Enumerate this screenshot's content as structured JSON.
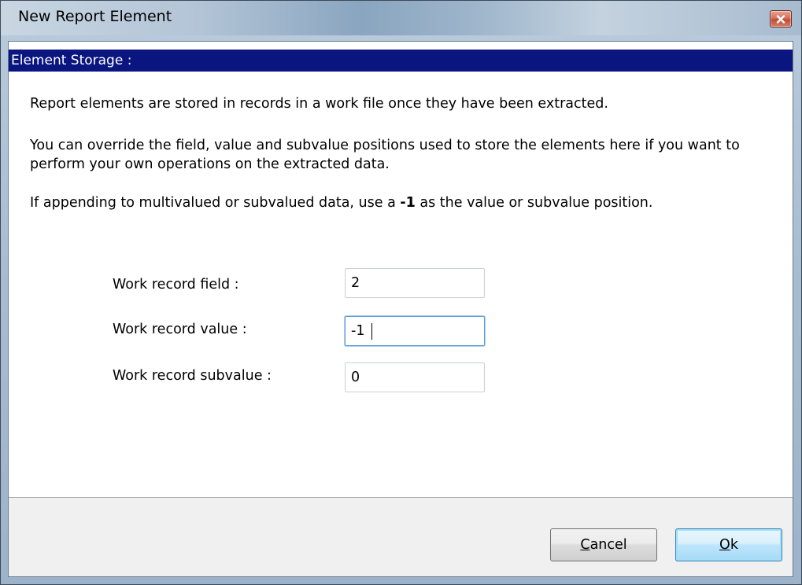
{
  "window": {
    "title": "New Report Element",
    "close_icon": "close-icon"
  },
  "section": {
    "header": "Element Storage :"
  },
  "description": {
    "p1": "Report elements are stored in records in a work file once they have been extracted.",
    "p2": "You can override the field, value and subvalue positions used to store the elements here if you want to perform your own operations on the extracted data.",
    "p3_before": "If appending to multivalued or subvalued data, use a ",
    "p3_bold": "-1",
    "p3_after": " as the value or subvalue position."
  },
  "fields": {
    "field_label": "Work record field :",
    "field_value": "2",
    "value_label": "Work record value :",
    "value_value": "-1",
    "subvalue_label": "Work record subvalue :",
    "subvalue_value": "0"
  },
  "buttons": {
    "cancel_accel": "C",
    "cancel_rest": "ancel",
    "ok_accel": "O",
    "ok_rest": "k"
  },
  "colors": {
    "header_bg": "#0a1580",
    "focus_border": "#5b9bd5"
  }
}
